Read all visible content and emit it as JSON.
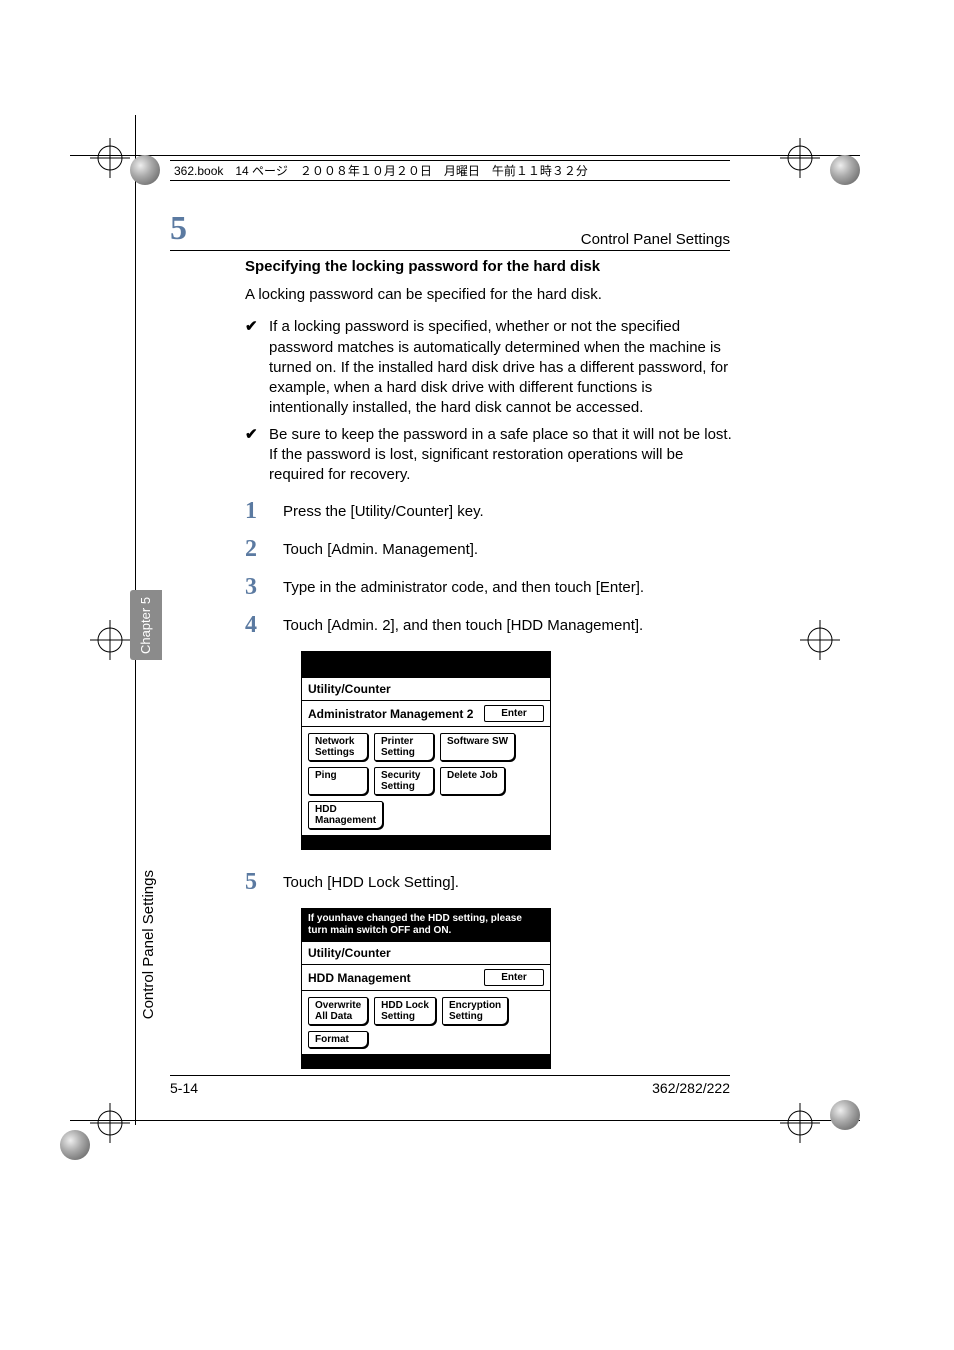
{
  "meta": {
    "book_header": "362.book　14 ページ　２００８年１０月２０日　月曜日　午前１１時３２分"
  },
  "header": {
    "chapter_number": "5",
    "chapter_title": "Control Panel Settings"
  },
  "sidebar": {
    "tab_label": "Chapter 5",
    "side_label": "Control Panel Settings"
  },
  "content": {
    "heading": "Specifying the locking password for the hard disk",
    "intro": "A locking password can be specified for the hard disk.",
    "checks": [
      "If a locking password is specified, whether or not the specified password matches is automatically determined when the machine is turned on. If the installed hard disk drive has a different password, for example, when a hard disk drive with different functions is intentionally installed, the hard disk cannot be accessed.",
      "Be sure to keep the password in a safe place so that it will not be lost. If the password is lost, significant restoration operations will be required for recovery."
    ],
    "steps": [
      {
        "n": "1",
        "text": "Press the [Utility/Counter] key."
      },
      {
        "n": "2",
        "text": "Touch [Admin. Management]."
      },
      {
        "n": "3",
        "text": "Type in the administrator code, and then touch [Enter]."
      },
      {
        "n": "4",
        "text": "Touch [Admin. 2], and then touch [HDD Management]."
      },
      {
        "n": "5",
        "text": "Touch [HDD Lock Setting]."
      }
    ]
  },
  "panel1": {
    "title": "Utility/Counter",
    "subtitle": "Administrator Management 2",
    "enter": "Enter",
    "buttons": {
      "network": "Network\nSettings",
      "printer": "Printer\nSetting",
      "software": "Software SW",
      "ping": "Ping",
      "security": "Security\nSetting",
      "delete": "Delete Job",
      "hdd": "HDD\nManagement"
    }
  },
  "panel2": {
    "instruction": "If younhave changed the HDD setting, please turn main switch OFF and ON.",
    "title": "Utility/Counter",
    "subtitle": "HDD Management",
    "enter": "Enter",
    "buttons": {
      "overwrite": "Overwrite\nAll Data",
      "hddlock": "HDD Lock\nSetting",
      "encryption": "Encryption\nSetting",
      "format": "Format"
    }
  },
  "footer": {
    "page": "5-14",
    "model": "362/282/222"
  }
}
